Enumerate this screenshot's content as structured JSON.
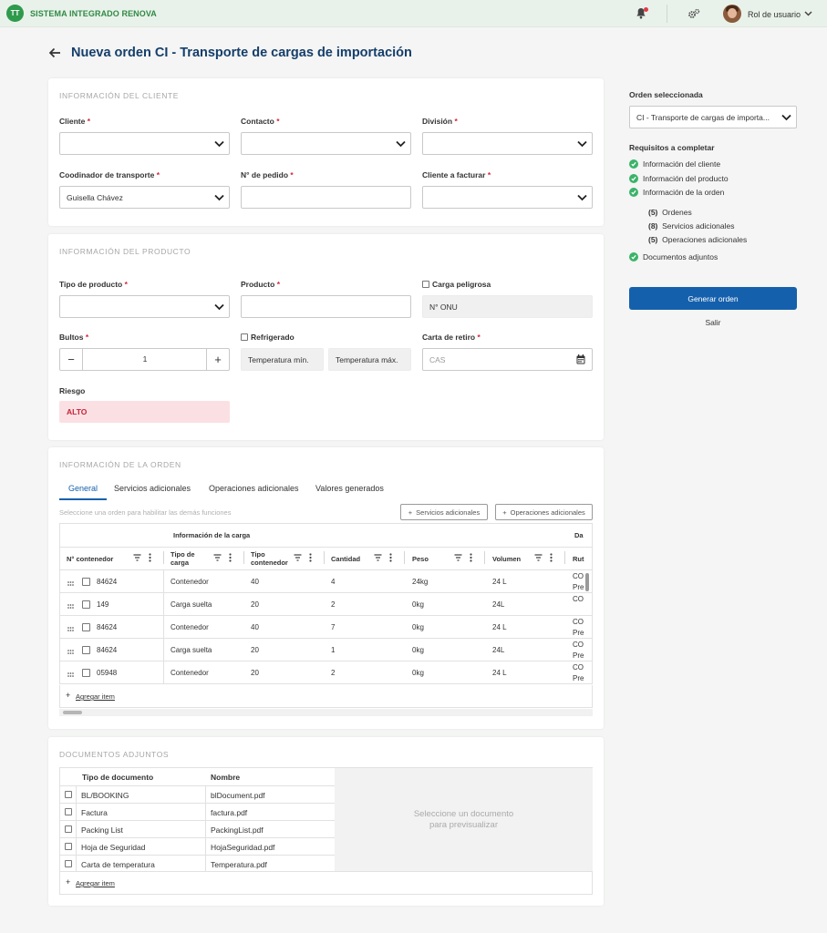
{
  "app": {
    "logo_text": "TT",
    "name": "SISTEMA INTEGRADO RENOVA",
    "user_role": "Rol de usuario"
  },
  "page": {
    "title": "Nueva orden CI - Transporte de cargas de importación"
  },
  "client_section": {
    "title": "INFORMACIÓN DEL CLIENTE",
    "cliente_label": "Cliente",
    "contacto_label": "Contacto",
    "division_label": "División",
    "coordinador_label": "Coodinador de transporte",
    "coordinador_value": "Guisella Chávez",
    "pedido_label": "N° de pedido",
    "facturar_label": "Cliente a facturar",
    "required_mark": "*"
  },
  "product_section": {
    "title": "Información del producto",
    "tipo_label": "Tipo de producto",
    "producto_label": "Producto",
    "carga_peligrosa_label": "Carga peligrosa",
    "onu_placeholder": "N° ONU",
    "bultos_label": "Bultos",
    "bultos_value": "1",
    "minus": "−",
    "plus": "+",
    "refrigerado_label": "Refrigerado",
    "temp_min_placeholder": "Temperatura mín.",
    "temp_max_placeholder": "Temperatura máx.",
    "carta_label": "Carta de retiro",
    "carta_placeholder": "CAS",
    "riesgo_label": "Riesgo",
    "riesgo_value": "ALTO"
  },
  "order_section": {
    "title": "Información de la orden",
    "tabs": [
      "General",
      "Servicios adicionales",
      "Operaciones adicionales",
      "Valores generados"
    ],
    "hint": "Seleccione una orden para habilitar las demás funciones",
    "btn_servicios": "Servicios adicionales",
    "btn_operaciones": "Operaciones adicionales",
    "group_header": "Información de la carga",
    "group_header_2": "Da",
    "columns": {
      "contenedor": "N° contenedor",
      "tipo_carga_1": "Tipo de",
      "tipo_carga_2": "carga",
      "tipo_cont_1": "Tipo",
      "tipo_cont_2": "contenedor",
      "cantidad": "Cantidad",
      "peso": "Peso",
      "volumen": "Volumen",
      "ruta": "Rut"
    },
    "rows": [
      {
        "contenedor": "84624",
        "tipo": "Contenedor",
        "tipo_cont": "40",
        "cantidad": "4",
        "peso": "24kg",
        "volumen": "24 L",
        "ruta_1": "CO",
        "ruta_2": "Pre"
      },
      {
        "contenedor": "149",
        "tipo": "Carga suelta",
        "tipo_cont": "20",
        "cantidad": "2",
        "peso": "0kg",
        "volumen": "24L",
        "ruta_1": "CO",
        "ruta_2": ""
      },
      {
        "contenedor": "84624",
        "tipo": "Contenedor",
        "tipo_cont": "40",
        "cantidad": "7",
        "peso": "0kg",
        "volumen": "24 L",
        "ruta_1": "CO",
        "ruta_2": "Pre"
      },
      {
        "contenedor": "84624",
        "tipo": "Carga suelta",
        "tipo_cont": "20",
        "cantidad": "1",
        "peso": "0kg",
        "volumen": "24L",
        "ruta_1": "CO",
        "ruta_2": "Pre"
      },
      {
        "contenedor": "05948",
        "tipo": "Contenedor",
        "tipo_cont": "20",
        "cantidad": "2",
        "peso": "0kg",
        "volumen": "24 L",
        "ruta_1": "CO",
        "ruta_2": "Pre"
      }
    ],
    "add_item": "Agregar item"
  },
  "documents_section": {
    "title": "DOCUMENTOS ADJUNTOS",
    "col_tipo": "Tipo de documento",
    "col_nombre": "Nombre",
    "rows": [
      {
        "tipo": "BL/BOOKING",
        "nombre": "blDocument.pdf"
      },
      {
        "tipo": "Factura",
        "nombre": "factura.pdf"
      },
      {
        "tipo": "Packing List",
        "nombre": "PackingList.pdf"
      },
      {
        "tipo": "Hoja de Seguridad",
        "nombre": "HojaSeguridad.pdf"
      },
      {
        "tipo": "Carta de temperatura",
        "nombre": "Temperatura.pdf"
      }
    ],
    "preview_line1": "Seleccione un documento",
    "preview_line2": "para previsualizar",
    "add_item": "Agregar item"
  },
  "right_panel": {
    "orden_label": "Orden seleccionada",
    "orden_value": "CI - Transporte de cargas de importa...",
    "requisitos_label": "Requisitos a completar",
    "items": [
      "Información del cliente",
      "Información del producto",
      "Información de la orden"
    ],
    "sub_items": [
      {
        "count": "(5)",
        "label": "Ordenes"
      },
      {
        "count": "(8)",
        "label": "Servicios adicionales"
      },
      {
        "count": "(5)",
        "label": "Operaciones adicionales"
      }
    ],
    "documentos": "Documentos adjuntos",
    "generate_button": "Generar orden",
    "exit_link": "Salir"
  },
  "colors": {
    "primary": "#1560ac",
    "title": "#153e6b",
    "brand_green": "#2f8a45",
    "success": "#3bb36a",
    "risk_bg": "#fbe0e3",
    "risk_text": "#c4223a"
  }
}
